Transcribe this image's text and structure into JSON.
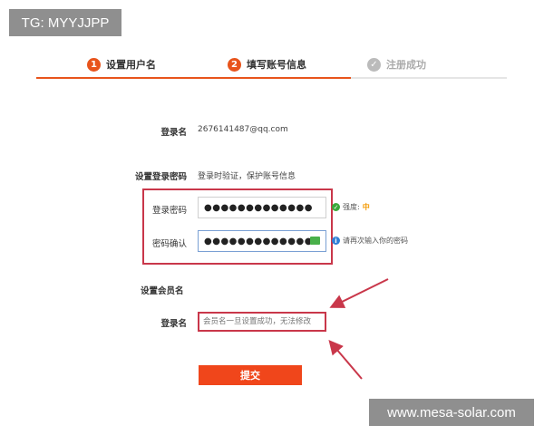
{
  "watermarks": {
    "top_left": "TG: MYYJJPP",
    "bottom_right": "www.mesa-solar.com"
  },
  "steps": [
    {
      "num": "1",
      "label": "设置用户名",
      "state": "done"
    },
    {
      "num": "2",
      "label": "填写账号信息",
      "state": "active"
    },
    {
      "num": "✓",
      "label": "注册成功",
      "state": "pending"
    }
  ],
  "login": {
    "label": "登录名",
    "value": "2676141487@qq.com"
  },
  "password_section": {
    "title": "设置登录密码",
    "subtitle": "登录时验证，保护账号信息",
    "password_label": "登录密码",
    "password_value": "●●●●●●●●●●●●●",
    "confirm_label": "密码确认",
    "confirm_value": "●●●●●●●●●●●●●",
    "strength_prefix": "强度:",
    "strength_value": "中",
    "confirm_hint": "请再次输入你的密码"
  },
  "member_section": {
    "title": "设置会员名",
    "label": "登录名",
    "placeholder": "会员名一旦设置成功，无法修改"
  },
  "submit_label": "提交",
  "colors": {
    "accent": "#e8541c",
    "annotation_red": "#c9374a",
    "submit": "#f0461b"
  }
}
